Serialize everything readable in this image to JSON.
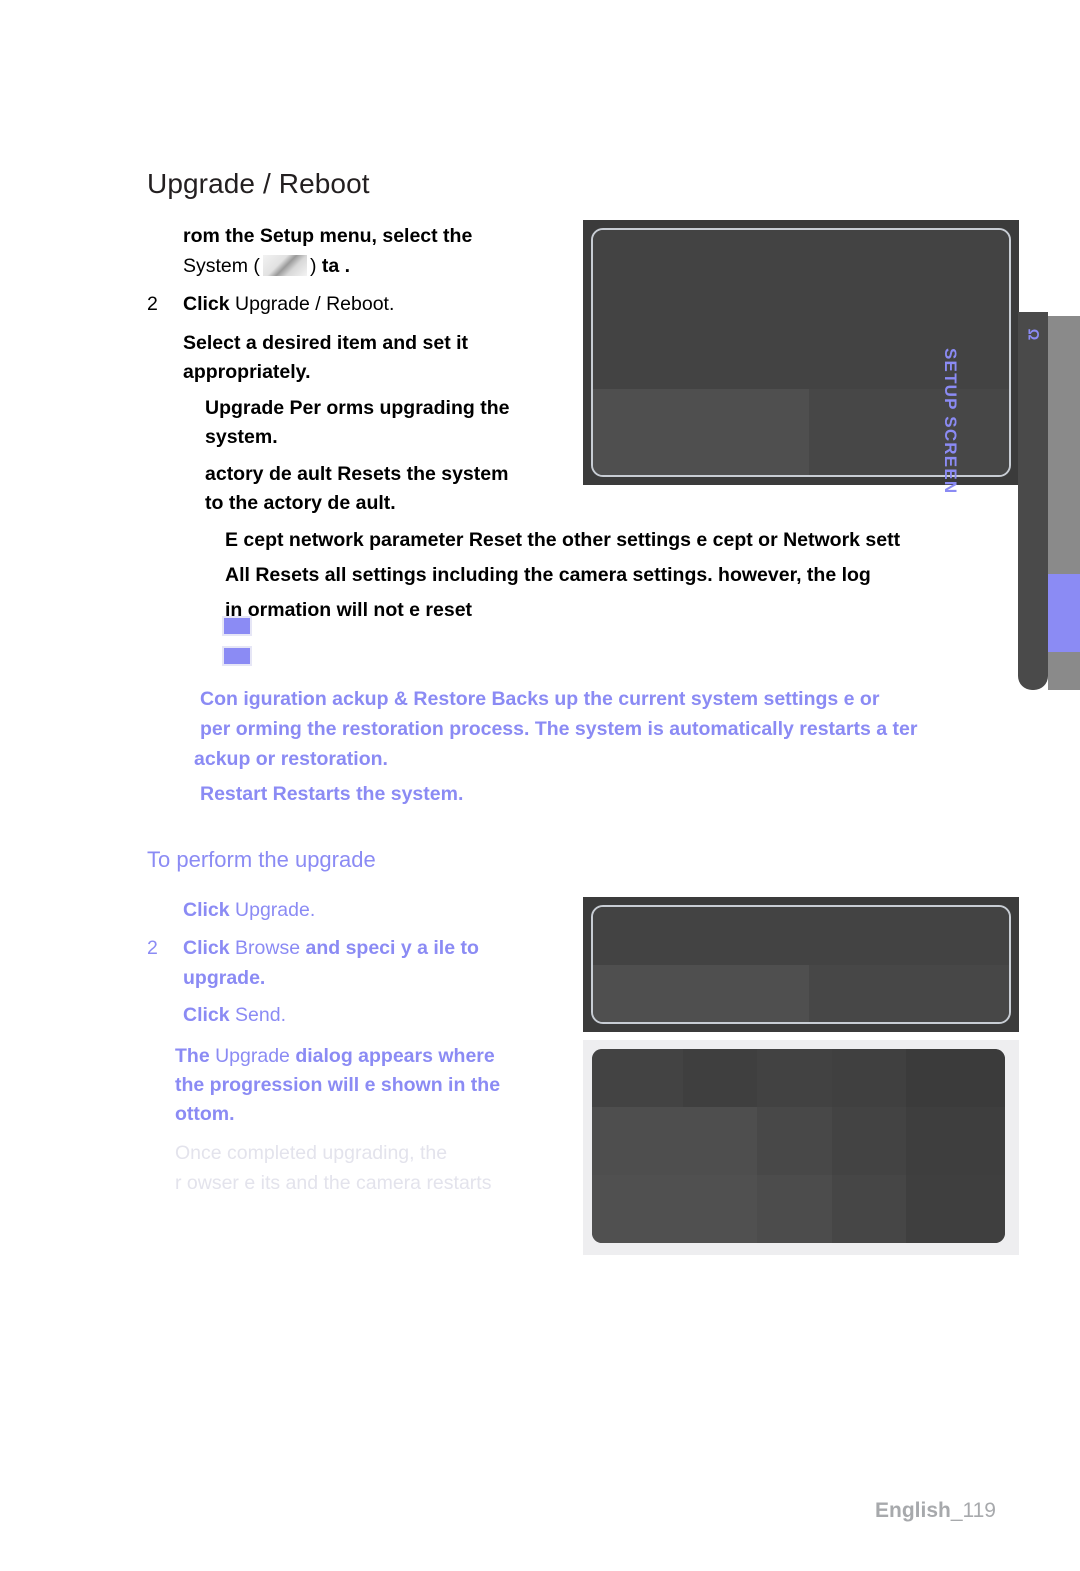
{
  "page": {
    "title": "Upgrade / Reboot",
    "footer_language": "English",
    "footer_page": "_119"
  },
  "colors": {
    "accent_purple": "#8b8bf4",
    "text_black": "#000000",
    "faded_gray": "#e3e3ec",
    "tab_dark": "#4a4a4a",
    "strip_gray": "#8a8a8a"
  },
  "upper_steps": [
    {
      "number": "",
      "line1_bold": "rom the Setup menu, select the",
      "line2_prefix": "System (",
      "line2_icon": "system-tab-icon",
      "line2_suffix": ")",
      "line2_bold": "ta ."
    },
    {
      "number": "2",
      "bold": "Click",
      "normal": "Upgrade / Reboot",
      "trailing": "."
    },
    {
      "number": "",
      "bold_line1": "Select a desired item and set it",
      "bold_line2": "appropriately."
    }
  ],
  "sub_items": [
    {
      "line1": "Upgrade   Per orms upgrading the",
      "line2": "system."
    },
    {
      "line1": " actory de ault   Resets the system",
      "line2": "to the  actory de ault."
    }
  ],
  "subsub_items": [
    {
      "line1": "E cept network parameter   Reset the other settings e cept  or Network sett"
    },
    {
      "line1": "All   Resets all settings including the camera settings.  however, the log",
      "line2": "in ormation will not  e reset"
    }
  ],
  "bullet_markers": [
    "purple-square-marker",
    "purple-square-marker"
  ],
  "purple_note": {
    "line1": "Con iguration  ackup & Restore   Backs up the current system settings  e or",
    "line2": "per orming the restoration process. The system is automatically restarts a ter",
    "line3": " ackup or restoration."
  },
  "restart_note": "Restart   Restarts the system.",
  "subheading": "To perform the upgrade",
  "lower_steps": [
    {
      "number": "",
      "bold": "Click",
      "normal": "Upgrade",
      "trailing": "."
    },
    {
      "number": "2",
      "bold": "Click",
      "normal": "Browse",
      "bold2": "and speci y a  ile to",
      "bold3": "upgrade."
    },
    {
      "number": "",
      "bold": "Click",
      "normal": "Send",
      "trailing": "."
    }
  ],
  "dialog_note": {
    "line1_bold_a": "The",
    "line1_normal": "Upgrade",
    "line1_bold_b": "dialog appears where",
    "line2": "the progression will  e shown in the",
    "line3": " ottom."
  },
  "faded_note": {
    "line1": "Once completed upgrading, the",
    "line2": " r owser e its and the camera restarts"
  },
  "side_tab": {
    "mark": "Ω",
    "label": "SETUP SCREEN"
  },
  "screenshots": [
    {
      "name": "setup-system-upgrade-reboot-screenshot"
    },
    {
      "name": "upgrade-browse-send-screenshot"
    },
    {
      "name": "upgrade-progress-dialog-screenshot"
    }
  ]
}
